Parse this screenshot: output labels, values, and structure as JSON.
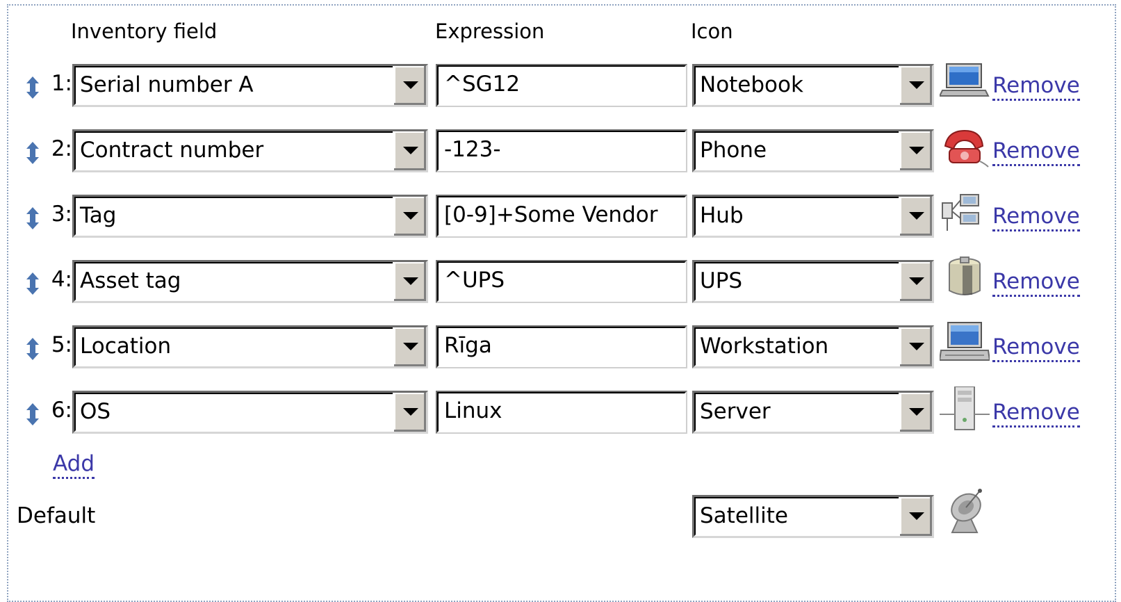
{
  "headers": {
    "inventory_field": "Inventory field",
    "expression": "Expression",
    "icon": "Icon"
  },
  "rows": [
    {
      "num": "1:",
      "field": "Serial number A",
      "expression": "^SG12",
      "icon": "Notebook",
      "icon_name": "notebook-icon",
      "remove": "Remove"
    },
    {
      "num": "2:",
      "field": "Contract number",
      "expression": "-123-",
      "icon": "Phone",
      "icon_name": "phone-icon",
      "remove": "Remove"
    },
    {
      "num": "3:",
      "field": "Tag",
      "expression": "[0-9]+Some Vendor",
      "icon": "Hub",
      "icon_name": "hub-icon",
      "remove": "Remove"
    },
    {
      "num": "4:",
      "field": "Asset tag",
      "expression": "^UPS",
      "icon": "UPS",
      "icon_name": "ups-icon",
      "remove": "Remove"
    },
    {
      "num": "5:",
      "field": "Location",
      "expression": "Rīga",
      "icon": "Workstation",
      "icon_name": "workstation-icon",
      "remove": "Remove"
    },
    {
      "num": "6:",
      "field": "OS",
      "expression": "Linux",
      "icon": "Server",
      "icon_name": "server-icon",
      "remove": "Remove"
    }
  ],
  "add_label": "Add",
  "default": {
    "label": "Default",
    "icon": "Satellite",
    "icon_name": "satellite-icon"
  },
  "colors": {
    "link": "#3b38a8",
    "handle": "#4a74b0",
    "frame_border": "#8fa3c0"
  }
}
